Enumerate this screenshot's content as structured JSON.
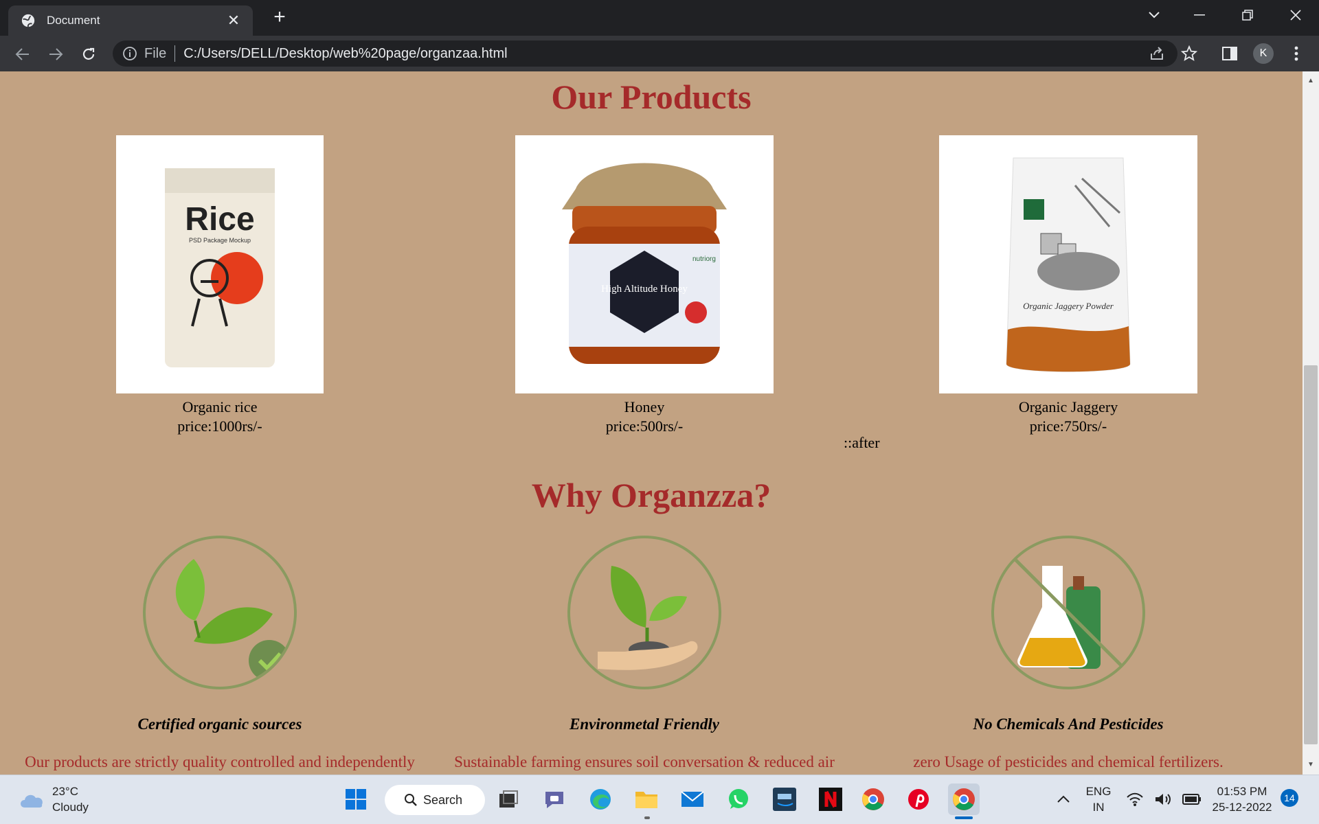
{
  "browser": {
    "tab_title": "Document",
    "omnibox_scheme_label": "File",
    "url": "C:/Users/DELL/Desktop/web%20page/organzaa.html",
    "profile_initial": "K"
  },
  "page": {
    "products_title": "Our Products",
    "products": [
      {
        "name": "Organic rice",
        "price": "price:1000rs/-",
        "image_text": "Rice",
        "image_subtext": "PSD Package Mockup"
      },
      {
        "name": "Honey",
        "price": "price:500rs/-",
        "image_text": "High Altitude Honey",
        "image_subtext": "nutriorg"
      },
      {
        "name": "Organic Jaggery",
        "price": "price:750rs/-",
        "image_text": "Organic Jaggery Powder",
        "image_subtext": ""
      }
    ],
    "after_label": "::after",
    "why_title": "Why Organzza?",
    "features": [
      {
        "title": "Certified organic sources",
        "desc": "Our products are strictly quality controlled and independently verified",
        "icon": "leaf-certified-icon"
      },
      {
        "title": "Environmetal Friendly",
        "desc": "Sustainable farming ensures soil conversation & reduced air pollution",
        "icon": "plant-in-hand-icon"
      },
      {
        "title": "No Chemicals And Pesticides",
        "desc": "zero Usage of pesticides and chemical fertilizers.",
        "icon": "no-chemicals-icon"
      }
    ]
  },
  "taskbar": {
    "weather_temp": "23°C",
    "weather_desc": "Cloudy",
    "search_label": "Search",
    "lang_top": "ENG",
    "lang_bottom": "IN",
    "time": "01:53 PM",
    "date": "25-12-2022",
    "notification_count": "14"
  },
  "colors": {
    "page_bg": "#c2a282",
    "heading": "#a52a2a",
    "chrome_dark": "#202124",
    "chrome_toolbar": "#35363a"
  }
}
